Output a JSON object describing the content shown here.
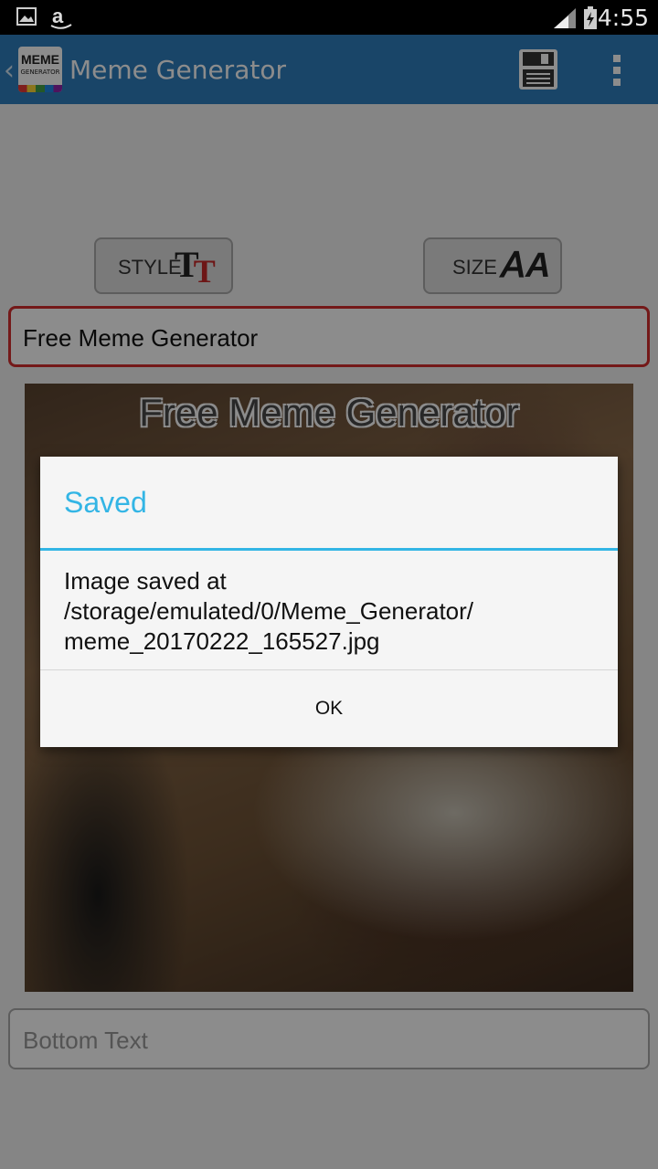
{
  "status_bar": {
    "time": "4:55"
  },
  "action_bar": {
    "title": "Meme Generator",
    "logo_text_top": "MEME",
    "logo_text_bottom": "GENERATOR",
    "accent_color": "#2f7fbd"
  },
  "toolbar": {
    "style_label": "STYLE",
    "size_label": "SIZE"
  },
  "top_text_input": {
    "value": "Free Meme Generator"
  },
  "meme": {
    "caption": "Free Meme Generator"
  },
  "bottom_text_input": {
    "placeholder": "Bottom Text"
  },
  "dialog": {
    "title": "Saved",
    "message_line1": "Image saved at",
    "message_line2": "/storage/emulated/0/Meme_Generator/",
    "message_line3": "meme_20170222_165527.jpg",
    "ok_label": "OK",
    "title_color": "#33b5e5"
  }
}
